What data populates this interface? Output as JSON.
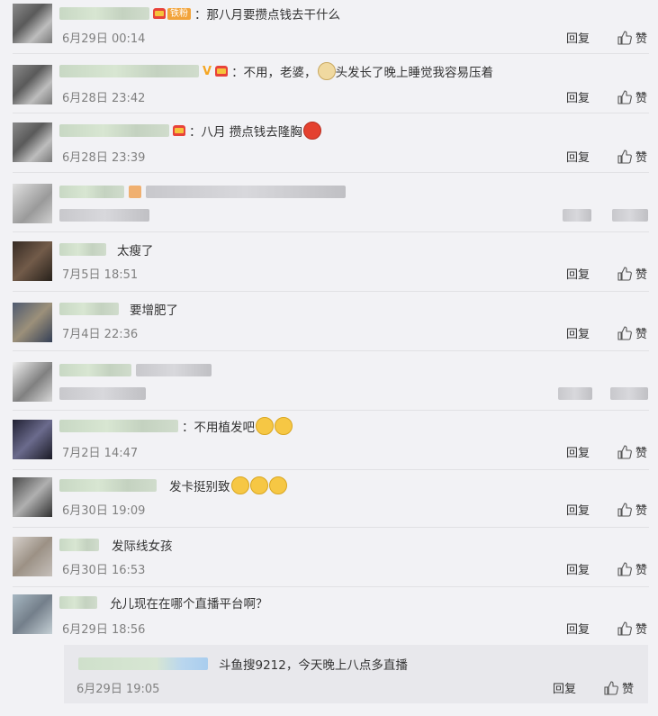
{
  "actions": {
    "reply": "回复",
    "like": "赞"
  },
  "comments": [
    {
      "text": "：那八月要攒点钱去干什么",
      "badge": "铁粉",
      "time": "6月29日 00:14"
    },
    {
      "text_a": "：不用，老婆，",
      "text_b": "头发长了晚上睡觉我容易压着",
      "time": "6月28日 23:42"
    },
    {
      "text": "：八月 攒点钱去隆胸",
      "time": "6月28日 23:39"
    },
    {
      "time": ""
    },
    {
      "text": "太瘦了",
      "time": "7月5日 18:51"
    },
    {
      "text": "要增肥了",
      "time": "7月4日 22:36"
    },
    {
      "time": ""
    },
    {
      "text": "：不用植发吧",
      "time": "7月2日 14:47"
    },
    {
      "text": "发卡挺别致",
      "time": "6月30日 19:09"
    },
    {
      "text": "发际线女孩",
      "time": "6月30日 16:53"
    },
    {
      "text": "允儿现在在哪个直播平台啊？",
      "time": "6月29日 18:56"
    }
  ],
  "sub_reply": {
    "text": "斗鱼搜9212，今天晚上八点多直播",
    "time": "6月29日 19:05"
  },
  "icons": {
    "like": "thumbs-up-icon",
    "avatar": "avatar"
  }
}
